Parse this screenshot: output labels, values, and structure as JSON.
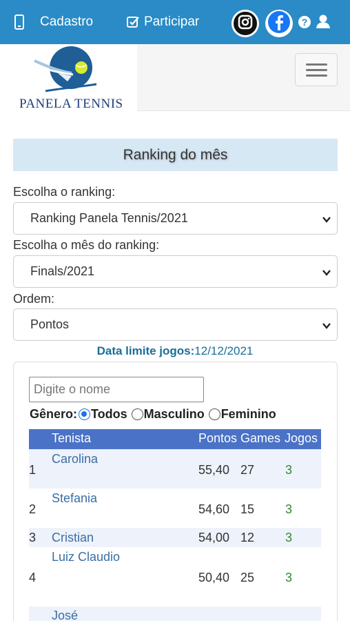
{
  "topbar": {
    "cadastro_label": "Cadastro",
    "participar_label": "Participar",
    "icons": [
      "phone-icon",
      "checkbox-icon",
      "instagram-icon",
      "facebook-icon",
      "help-icon",
      "user-icon"
    ]
  },
  "logo": {
    "text": "PANELA TENNIS"
  },
  "page": {
    "title": "Ranking do mês"
  },
  "form": {
    "ranking_label": "Escolha o ranking:",
    "ranking_value": "Ranking Panela Tennis/2021",
    "month_label": "Escolha o mês do ranking:",
    "month_value": "Finals/2021",
    "order_label": "Ordem:",
    "order_value": "Pontos"
  },
  "deadline": {
    "label": "Data limite jogos:",
    "value": "12/12/2021"
  },
  "search": {
    "placeholder": "Digite o nome"
  },
  "gender": {
    "label": "Gênero:",
    "options": [
      "Todos",
      "Masculino",
      "Feminino"
    ],
    "selected": "Todos"
  },
  "table": {
    "headers": [
      "Tenista",
      "Pontos",
      "Games",
      "Jogos"
    ],
    "rows": [
      {
        "pos": "1",
        "name": "Carolina",
        "pontos": "55,40",
        "games": "27",
        "jogos": "3"
      },
      {
        "pos": "2",
        "name": "Stefania",
        "pontos": "54,60",
        "games": "15",
        "jogos": "3"
      },
      {
        "pos": "3",
        "name": "Cristian",
        "pontos": "54,00",
        "games": "12",
        "jogos": "3"
      },
      {
        "pos": "4",
        "name": "Luiz Claudio",
        "pontos": "50,40",
        "games": "25",
        "jogos": "3"
      },
      {
        "pos": "",
        "name": "José",
        "pontos": "",
        "games": "",
        "jogos": ""
      }
    ]
  },
  "colors": {
    "topbar": "#2a8bc6",
    "title_bg": "#d7e8f5",
    "table_header": "#4a72c6",
    "name_link": "#3a6ea5",
    "jogos_green": "#2f8a2f"
  }
}
